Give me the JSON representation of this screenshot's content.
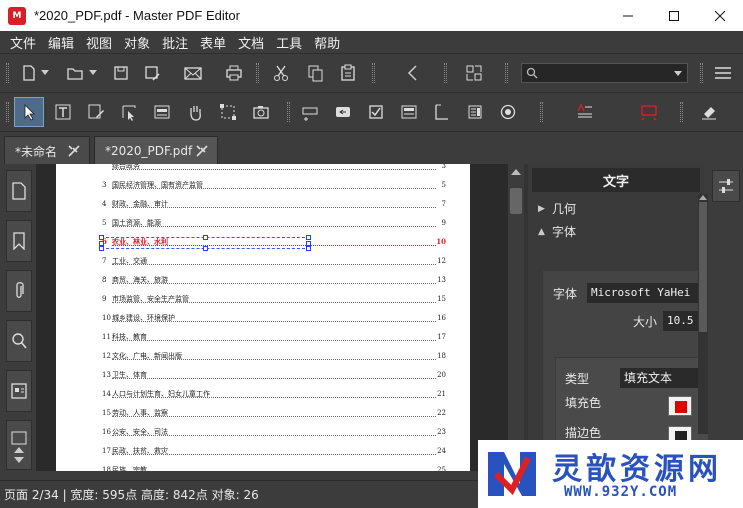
{
  "window": {
    "title": "*2020_PDF.pdf - Master PDF Editor",
    "app_icon_text": "M"
  },
  "menu": [
    "文件",
    "编辑",
    "视图",
    "对象",
    "批注",
    "表单",
    "文档",
    "工具",
    "帮助"
  ],
  "search": {
    "placeholder": "",
    "value": ""
  },
  "tabs": [
    {
      "label": "*未命名",
      "active": false
    },
    {
      "label": "*2020_PDF.pdf",
      "active": true
    }
  ],
  "document": {
    "toc": [
      {
        "num": "",
        "title": "综合政务",
        "page": "3",
        "selected": false
      },
      {
        "num": "3",
        "title": "国民经济管理、国有资产监管",
        "page": "5",
        "selected": false
      },
      {
        "num": "4",
        "title": "财政、金融、审计",
        "page": "7",
        "selected": false
      },
      {
        "num": "5",
        "title": "国土资源、能源",
        "page": "9",
        "selected": false
      },
      {
        "num": "6",
        "title": "农业、林业、水利",
        "page": "10",
        "selected": true
      },
      {
        "num": "7",
        "title": "工业、交通",
        "page": "12",
        "selected": false
      },
      {
        "num": "8",
        "title": "商贸、海关、旅游",
        "page": "13",
        "selected": false
      },
      {
        "num": "9",
        "title": "市场监管、安全生产监管",
        "page": "15",
        "selected": false
      },
      {
        "num": "10",
        "title": "城乡建设、环境保护",
        "page": "16",
        "selected": false
      },
      {
        "num": "11",
        "title": "科技、教育",
        "page": "17",
        "selected": false
      },
      {
        "num": "12",
        "title": "文化、广电、新闻出版",
        "page": "18",
        "selected": false
      },
      {
        "num": "13",
        "title": "卫生、体育",
        "page": "20",
        "selected": false
      },
      {
        "num": "14",
        "title": "人口与计划生育、妇女儿童工作",
        "page": "21",
        "selected": false
      },
      {
        "num": "15",
        "title": "劳动、人事、监察",
        "page": "22",
        "selected": false
      },
      {
        "num": "16",
        "title": "公安、安全、司法",
        "page": "23",
        "selected": false
      },
      {
        "num": "17",
        "title": "民政、扶贫、救灾",
        "page": "24",
        "selected": false
      },
      {
        "num": "18",
        "title": "民族、宗教",
        "page": "25",
        "selected": false
      }
    ]
  },
  "panel": {
    "header": "文字",
    "sections": {
      "geometry": "几何",
      "font": "字体"
    },
    "font_label": "字体",
    "font_value": "Microsoft YaHei",
    "size_label": "大小",
    "size_value": "10.5",
    "type_label": "类型",
    "type_value": "填充文本",
    "fill_label": "填充色",
    "stroke_label": "描边色",
    "fill_color": "#e00000",
    "stroke_color": "#222222"
  },
  "status": "页面 2/34 | 宽度: 595点 高度: 842点 对象: 26",
  "watermark": {
    "title": "灵歆资源网",
    "url": "WWW.932Y.COM"
  }
}
